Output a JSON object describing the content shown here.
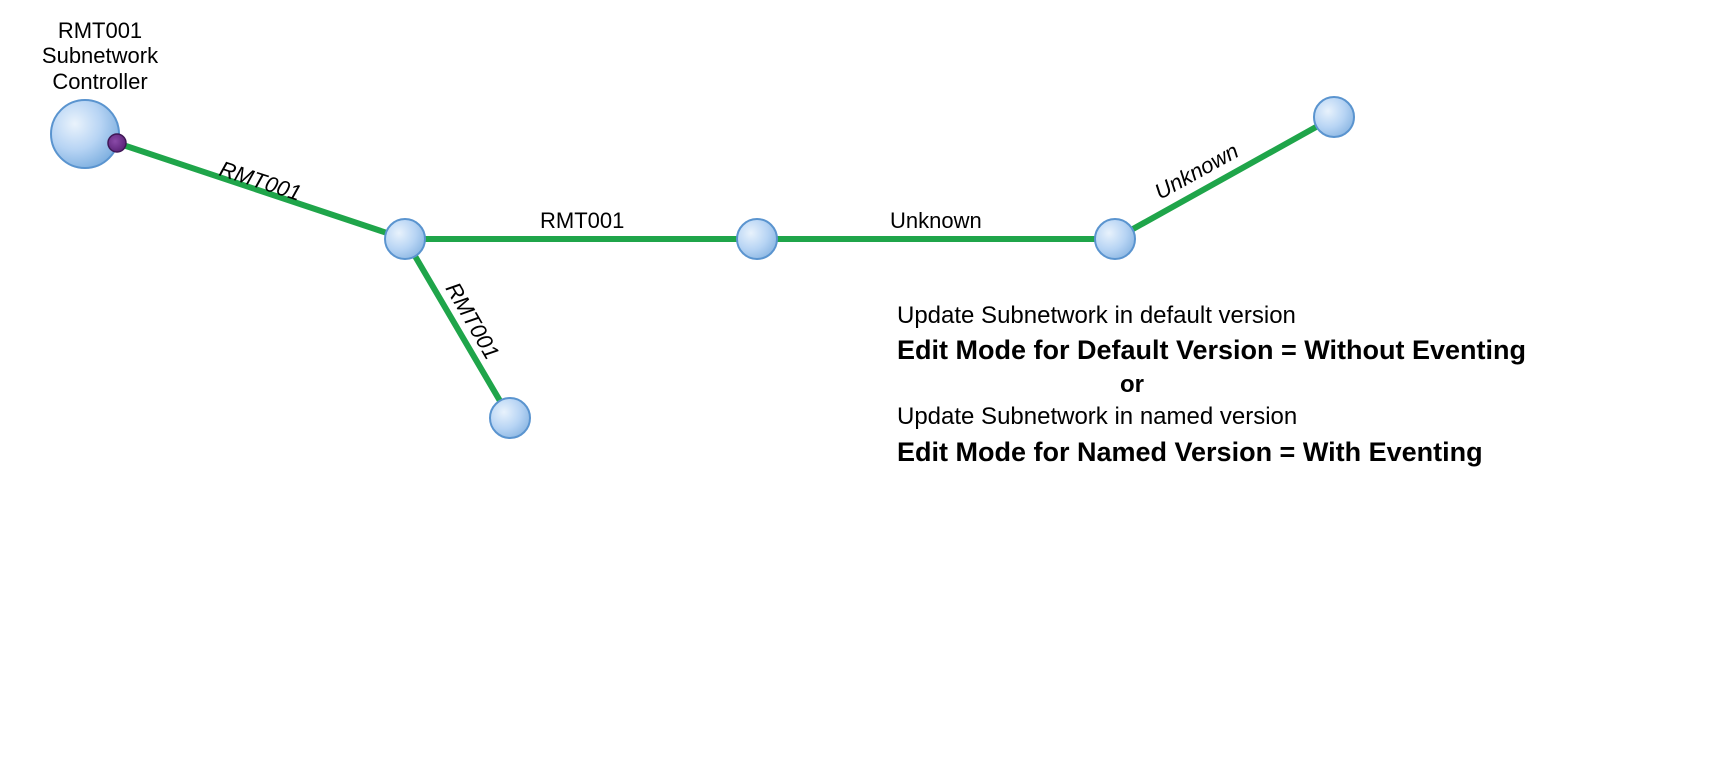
{
  "controller": {
    "line1": "RMT001",
    "line2": "Subnetwork",
    "line3": "Controller"
  },
  "edges": {
    "e1": "RMT001",
    "e2": "RMT001",
    "e3": "RMT001",
    "e4": "Unknown",
    "e5": "Unknown"
  },
  "info": {
    "line1": "Update Subnetwork in default version",
    "line2": "Edit Mode for Default Version = Without Eventing",
    "or": "or",
    "line3": "Update Subnetwork in named version",
    "line4": "Edit Mode for Named Version = With Eventing"
  },
  "colors": {
    "edge": "#1fa54a",
    "nodeFill": "#b7d4f4",
    "nodeStroke": "#4a88c7",
    "subnodeFill": "#6d2a8a",
    "subnodeStroke": "#4b1c60"
  }
}
